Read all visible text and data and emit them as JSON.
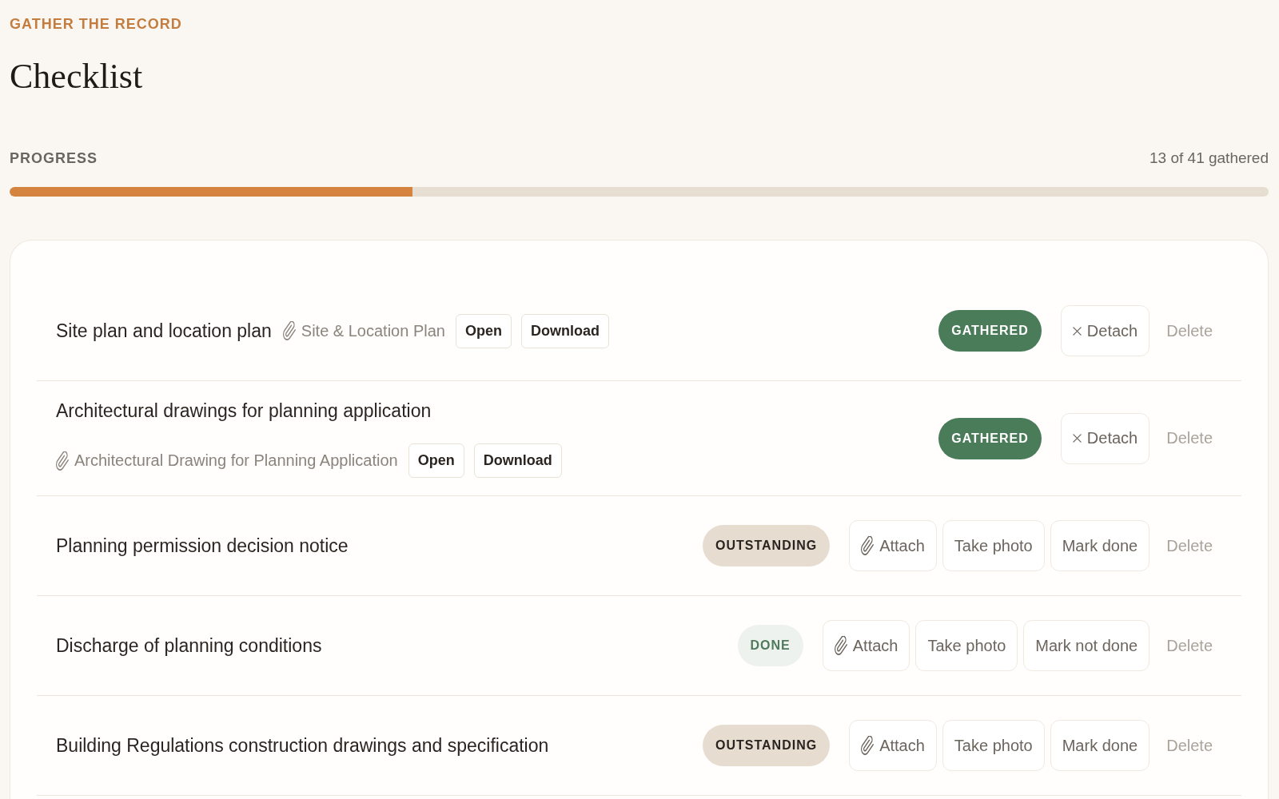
{
  "header": {
    "eyebrow": "GATHER THE RECORD",
    "title": "Checklist"
  },
  "progress": {
    "label": "PROGRESS",
    "count": "13 of 41 gathered",
    "level": 0.32
  },
  "items": [
    {
      "title": "Site plan and location plan",
      "status": {
        "kind": "gathered",
        "label": "GATHERED"
      },
      "attachment": {
        "name": "Site & Location Plan",
        "actions": [
          "Open",
          "Download"
        ]
      },
      "actions": [
        {
          "kind": "detach",
          "label": "Detach"
        },
        {
          "kind": "delete",
          "label": "Delete"
        }
      ]
    },
    {
      "title": "Architectural drawings for planning application",
      "status": {
        "kind": "gathered",
        "label": "GATHERED"
      },
      "attachment": {
        "name": "Architectural Drawing for Planning Application",
        "actions": [
          "Open",
          "Download"
        ]
      },
      "actions": [
        {
          "kind": "detach",
          "label": "Detach"
        },
        {
          "kind": "delete",
          "label": "Delete"
        }
      ]
    },
    {
      "title": "Planning permission decision notice",
      "status": {
        "kind": "outstanding",
        "label": "OUTSTANDING"
      },
      "actions": [
        {
          "kind": "attach",
          "label": "Attach"
        },
        {
          "kind": "photo",
          "label": "Take photo"
        },
        {
          "kind": "mark",
          "label": "Mark done"
        },
        {
          "kind": "delete",
          "label": "Delete"
        }
      ]
    },
    {
      "title": "Discharge of planning conditions",
      "status": {
        "kind": "done",
        "label": "DONE"
      },
      "actions": [
        {
          "kind": "attach",
          "label": "Attach"
        },
        {
          "kind": "photo",
          "label": "Take photo"
        },
        {
          "kind": "mark",
          "label": "Mark not done"
        },
        {
          "kind": "delete",
          "label": "Delete"
        }
      ]
    },
    {
      "title": "Building Regulations construction drawings and specification",
      "status": {
        "kind": "outstanding",
        "label": "OUTSTANDING"
      },
      "actions": [
        {
          "kind": "attach",
          "label": "Attach"
        },
        {
          "kind": "photo",
          "label": "Take photo"
        },
        {
          "kind": "mark",
          "label": "Mark done"
        },
        {
          "kind": "delete",
          "label": "Delete"
        }
      ]
    }
  ]
}
